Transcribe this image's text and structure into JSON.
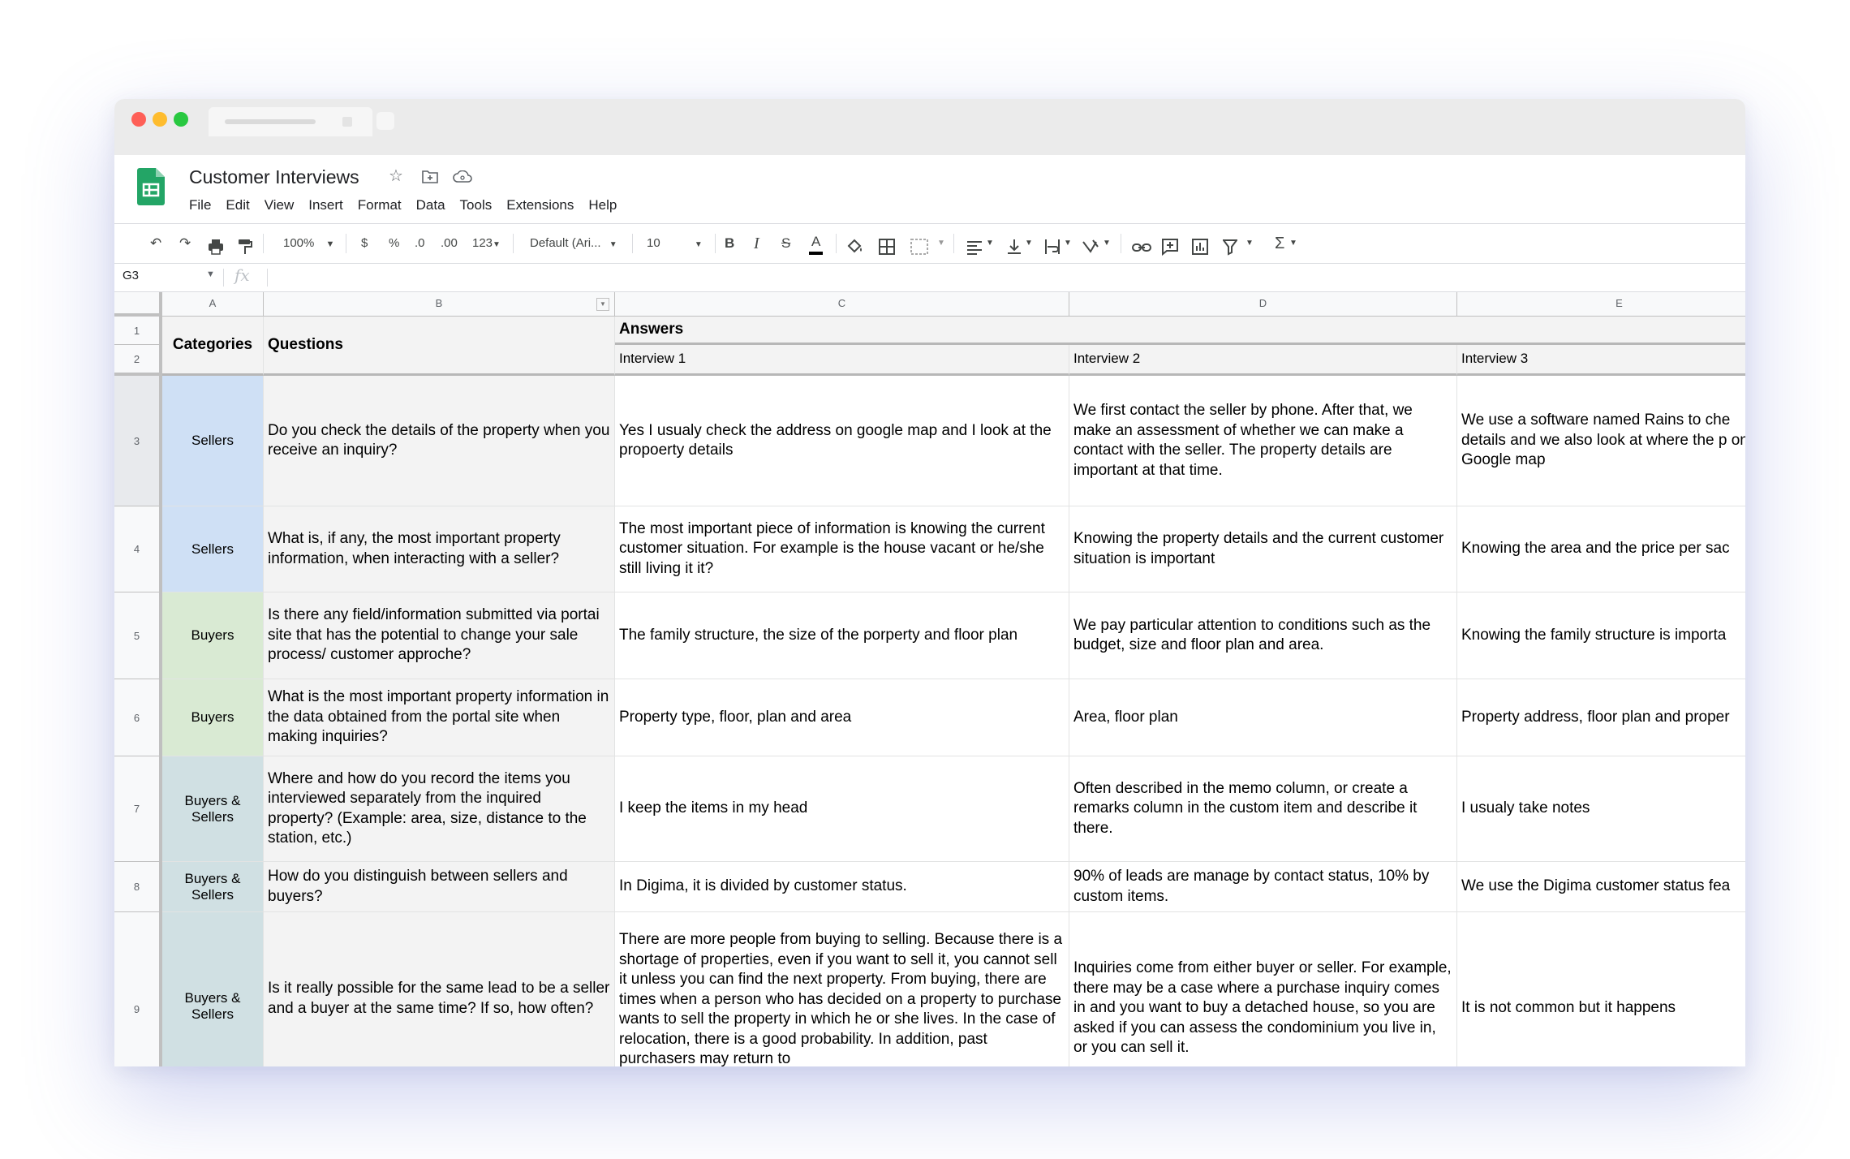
{
  "window": {
    "traffic_lights": [
      "#fe5f57",
      "#febc2e",
      "#28c840"
    ]
  },
  "app": {
    "title": "Customer Interviews",
    "header_icons": [
      "star-icon",
      "move-to-folder-icon",
      "cloud-status-icon"
    ],
    "menu": [
      "File",
      "Edit",
      "View",
      "Insert",
      "Format",
      "Data",
      "Tools",
      "Extensions",
      "Help"
    ]
  },
  "toolbar": {
    "zoom": "100%",
    "currency": "$",
    "percent": "%",
    "decrease_decimal": ".0",
    "increase_decimal": ".00",
    "more_formats": "123",
    "font": "Default (Ari...",
    "font_size": "10",
    "bold": "B",
    "italic": "I",
    "strike": "S",
    "text_color": "A",
    "sum": "Σ"
  },
  "formula_bar": {
    "name_box": "G3",
    "fx": "fx",
    "value": ""
  },
  "sheet": {
    "columns": [
      "A",
      "B",
      "C",
      "D",
      "E"
    ],
    "row_numbers": [
      "1",
      "2",
      "3",
      "4",
      "5",
      "6",
      "7",
      "8",
      "9"
    ],
    "selected_row": "3",
    "header": {
      "categories": "Categories",
      "questions": "Questions",
      "answers": "Answers",
      "interviews": [
        "Interview 1",
        "Interview 2",
        "Interview 3"
      ]
    },
    "category_colors": {
      "Sellers": "#cfe0f5",
      "Buyers": "#d9ead3",
      "Buyers & Sellers": "#d0e0e3"
    },
    "rows": [
      {
        "category": "Sellers",
        "question": "Do you check the details of the property when you receive an inquiry?",
        "answers": [
          "Yes I usualy check the address on google map and I look at the propoerty details",
          "We first contact the seller by phone. After that, we make an assessment of whether we can make a contact with the seller. The property details are important at that time.",
          "We use a software named Rains to che details and we also look at where the p on Google map"
        ]
      },
      {
        "category": "Sellers",
        "question": "What is, if any, the most important property information, when interacting with a seller?",
        "answers": [
          "The most important piece of information is knowing the current customer situation. For example is the house vacant or he/she still living it it?",
          "Knowing the property details and the current customer situation is important",
          "Knowing the area and the price per sac"
        ]
      },
      {
        "category": "Buyers",
        "question": "Is there any field/information submitted via portai site that has the potential to change your sale process/ customer approche?",
        "answers": [
          "The family structure, the size of the porperty and floor plan",
          "We pay particular attention to conditions such as the budget, size and floor plan and area.",
          "Knowing the family structure is importa"
        ]
      },
      {
        "category": "Buyers",
        "question": "What is the most important property information in the data obtained from the portal site when making inquiries?",
        "answers": [
          "Property type, floor, plan and area",
          "Area, floor plan",
          "Property address, floor plan and proper"
        ]
      },
      {
        "category": "Buyers & Sellers",
        "question": "Where and how do you record the items you interviewed separately from the inquired property? (Example: area, size, distance to the station, etc.)",
        "answers": [
          "I keep the items in my head",
          "Often described in the memo column, or create a remarks column in the custom item and describe it there.",
          "I usualy take notes"
        ]
      },
      {
        "category": "Buyers & Sellers",
        "question": "How do you distinguish between sellers and buyers?",
        "answers": [
          "In Digima, it is divided by customer status.",
          "90% of leads are manage by contact status, 10% by custom items.",
          "We use the Digima customer status fea"
        ]
      },
      {
        "category": "Buyers & Sellers",
        "question": "Is it really possible for the same lead to be a seller and a buyer at the same time? If so, how often?",
        "answers": [
          "There are more people from buying to selling. Because there is a shortage of properties, even if you want to sell it, you cannot sell it unless you can find the next property. From buying, there are times when a person who has decided on a property to purchase wants to sell the property in which he or she lives. In the case of relocation, there is a good probability. In addition, past purchasers may return to",
          "Inquiries come from either buyer or seller. For example, there may be a case where a purchase inquiry comes in and you want to buy a detached house, so you are asked if you can assess the condominium you live in, or you can sell it.",
          "It is not common but it happens"
        ]
      }
    ]
  }
}
